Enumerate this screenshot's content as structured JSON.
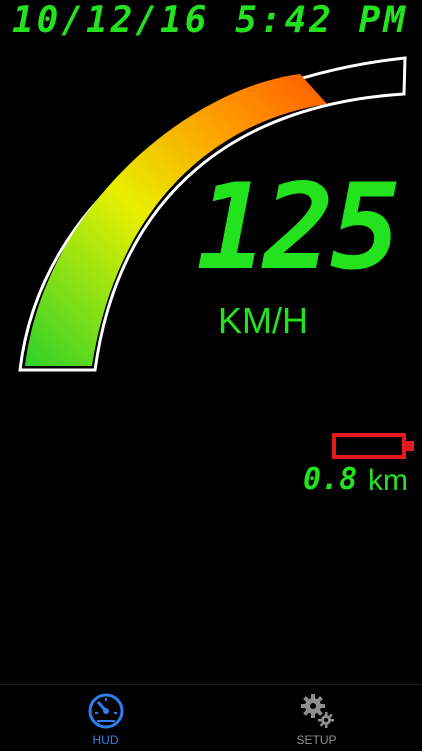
{
  "status": {
    "date": "10/12/16",
    "time": "5:42 PM"
  },
  "speedometer": {
    "speed": "125",
    "unit": "KM/H",
    "gauge_level": 0.85
  },
  "trip": {
    "distance_value": "0.8",
    "distance_unit": "km"
  },
  "battery": {
    "color": "#e61a1a"
  },
  "colors": {
    "segment_green": "#22e31e",
    "active_tab": "#2f7ff0",
    "inactive_tab": "#8e8e8e"
  },
  "tabs": [
    {
      "label": "HUD",
      "icon": "speedometer-icon",
      "active": true
    },
    {
      "label": "SETUP",
      "icon": "gears-icon",
      "active": false
    }
  ]
}
